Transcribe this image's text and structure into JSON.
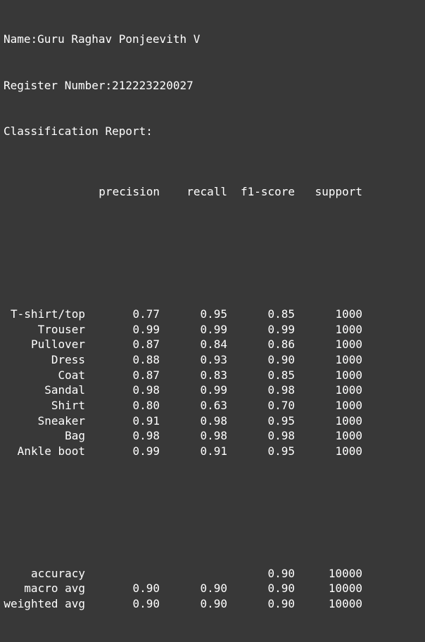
{
  "header_lines": {
    "name": "Name:Guru Raghav Ponjeevith V",
    "register": "Register Number:212223220027",
    "title": "Classification Report:"
  },
  "columns": {
    "precision": "precision",
    "recall": "recall",
    "f1": "f1-score",
    "support": "support"
  },
  "classes": [
    {
      "label": "T-shirt/top",
      "precision": "0.77",
      "recall": "0.95",
      "f1": "0.85",
      "support": "1000"
    },
    {
      "label": "Trouser",
      "precision": "0.99",
      "recall": "0.99",
      "f1": "0.99",
      "support": "1000"
    },
    {
      "label": "Pullover",
      "precision": "0.87",
      "recall": "0.84",
      "f1": "0.86",
      "support": "1000"
    },
    {
      "label": "Dress",
      "precision": "0.88",
      "recall": "0.93",
      "f1": "0.90",
      "support": "1000"
    },
    {
      "label": "Coat",
      "precision": "0.87",
      "recall": "0.83",
      "f1": "0.85",
      "support": "1000"
    },
    {
      "label": "Sandal",
      "precision": "0.98",
      "recall": "0.99",
      "f1": "0.98",
      "support": "1000"
    },
    {
      "label": "Shirt",
      "precision": "0.80",
      "recall": "0.63",
      "f1": "0.70",
      "support": "1000"
    },
    {
      "label": "Sneaker",
      "precision": "0.91",
      "recall": "0.98",
      "f1": "0.95",
      "support": "1000"
    },
    {
      "label": "Bag",
      "precision": "0.98",
      "recall": "0.98",
      "f1": "0.98",
      "support": "1000"
    },
    {
      "label": "Ankle boot",
      "precision": "0.99",
      "recall": "0.91",
      "f1": "0.95",
      "support": "1000"
    }
  ],
  "summary": [
    {
      "label": "accuracy",
      "precision": "",
      "recall": "",
      "f1": "0.90",
      "support": "10000"
    },
    {
      "label": "macro avg",
      "precision": "0.90",
      "recall": "0.90",
      "f1": "0.90",
      "support": "10000"
    },
    {
      "label": "weighted avg",
      "precision": "0.90",
      "recall": "0.90",
      "f1": "0.90",
      "support": "10000"
    }
  ],
  "colors": {
    "background": "#383838",
    "text": "#ffffff"
  }
}
